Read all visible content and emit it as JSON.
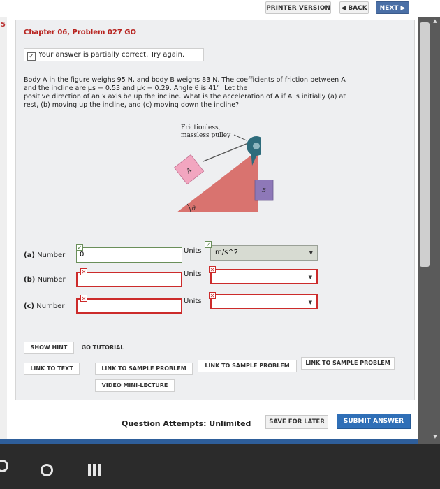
{
  "topnav": {
    "printer_version": "PRINTER VERSION",
    "back": "◀ BACK",
    "next": "NEXT ▶"
  },
  "problem": {
    "chapter_title": "Chapter 06, Problem 027 GO",
    "feedback": "Your answer is partially correct.  Try again.",
    "question_lines": [
      "Body A in the figure weighs 95 N, and body B weighs 83 N. The coefficients of friction between A",
      "and the incline are μs = 0.53 and μk = 0.29. Angle θ is 41°. Let the",
      "positive direction of an x axis be up the incline. What is the acceleration of A if A is initially (a) at",
      "rest, (b) moving up the incline, and (c) moving down the incline?"
    ]
  },
  "figure": {
    "label_line1": "Frictionless,",
    "label_line2": "massless pulley",
    "block_a": "A",
    "block_b": "B",
    "angle": "θ"
  },
  "answers": {
    "units_label": "Units",
    "rows": [
      {
        "label_part": "(a)",
        "label_rest": " Number",
        "value": "0",
        "unit": "m/s^2",
        "status": "ok"
      },
      {
        "label_part": "(b)",
        "label_rest": " Number",
        "value": "",
        "unit": "",
        "status": "bad"
      },
      {
        "label_part": "(c)",
        "label_rest": " Number",
        "value": "",
        "unit": "",
        "status": "bad"
      }
    ]
  },
  "links": {
    "show_hint": "SHOW HINT",
    "go_tutorial": "GO TUTORIAL",
    "link_to_text": "LINK TO TEXT",
    "sample_1": "LINK TO SAMPLE PROBLEM",
    "sample_2": "LINK TO SAMPLE PROBLEM",
    "sample_3": "LINK TO SAMPLE PROBLEM",
    "video": "VIDEO MINI-LECTURE"
  },
  "footer": {
    "attempts": "Question Attempts: Unlimited",
    "save_later": "SAVE FOR LATER",
    "submit": "SUBMIT ANSWER"
  },
  "colors": {
    "title_red": "#b7221e",
    "submit_blue": "#2f6fb7",
    "next_blue": "#4a6fa6",
    "error_red": "#cc2b2b",
    "incline": "#d9736f",
    "block_a": "#f2a6c0",
    "block_b": "#8e78b8",
    "pulley": "#2e6c7c"
  }
}
